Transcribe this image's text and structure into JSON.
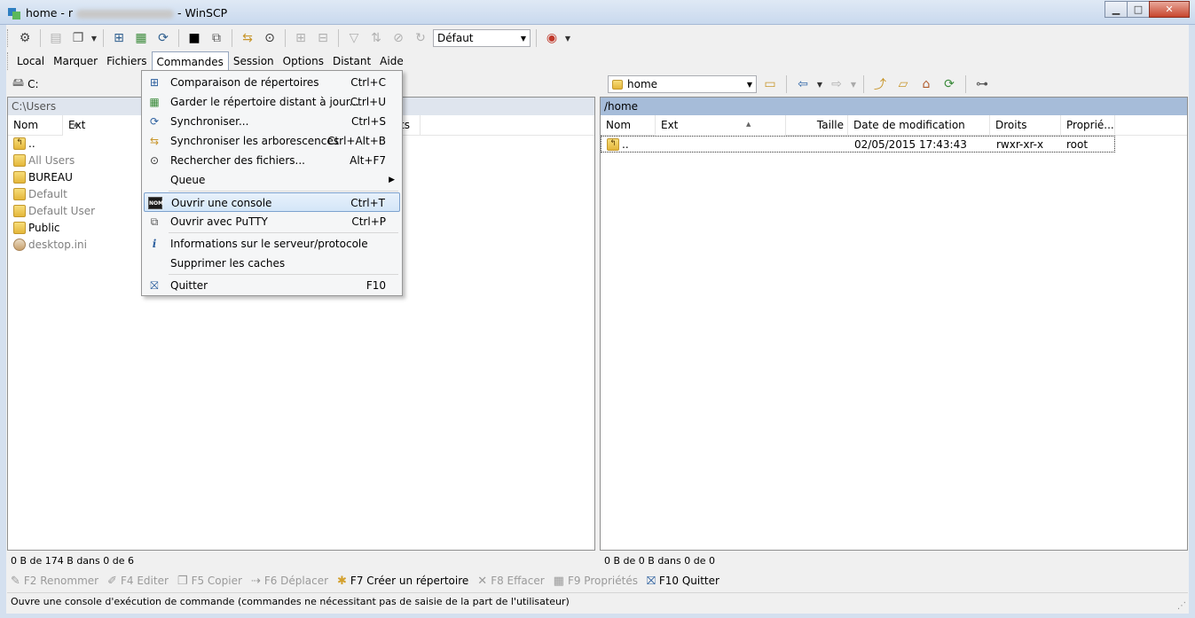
{
  "window": {
    "title_prefix": "home - r",
    "title_suffix": "- WinSCP",
    "buttons": {
      "minimize": "▁",
      "maximize": "□",
      "close": "✕"
    }
  },
  "toolbar": {
    "transfer_preset": "Défaut"
  },
  "menubar": {
    "items": [
      "Local",
      "Marquer",
      "Fichiers",
      "Commandes",
      "Session",
      "Options",
      "Distant",
      "Aide"
    ]
  },
  "left_panel": {
    "drive": "C:",
    "path": "C:\\Users",
    "columns": {
      "name": "Nom",
      "ext": "Ext",
      "hidden_tail": "ts"
    },
    "rows": [
      {
        "name": "..",
        "icon": "parent-folder-icon",
        "hidden": false
      },
      {
        "name": "All Users",
        "icon": "folder-icon",
        "hidden": true
      },
      {
        "name": "BUREAU",
        "icon": "folder-icon",
        "hidden": false
      },
      {
        "name": "Default",
        "icon": "folder-icon",
        "hidden": true
      },
      {
        "name": "Default User",
        "icon": "folder-icon",
        "hidden": true
      },
      {
        "name": "Public",
        "icon": "folder-icon",
        "hidden": false
      },
      {
        "name": "desktop.ini",
        "icon": "settings-file-icon",
        "hidden": true
      }
    ],
    "status": "0 B de 174 B dans 0 de 6"
  },
  "right_panel": {
    "path_combo": "home",
    "path": "/home",
    "columns": {
      "name": "Nom",
      "ext": "Ext",
      "size": "Taille",
      "modified": "Date de modification",
      "rights": "Droits",
      "owner": "Proprié..."
    },
    "rows": [
      {
        "name": "..",
        "modified": "02/05/2015 17:43:43",
        "rights": "rwxr-xr-x",
        "owner": "root"
      }
    ],
    "status": "0 B de 0 B dans 0 de 0"
  },
  "commands_menu": {
    "items": [
      {
        "label": "Comparaison de répertoires",
        "shortcut": "Ctrl+C",
        "icon": "compare-directories-icon"
      },
      {
        "label": "Garder le répertoire distant à jour...",
        "shortcut": "Ctrl+U",
        "icon": "keep-up-to-date-icon"
      },
      {
        "label": "Synchroniser...",
        "shortcut": "Ctrl+S",
        "icon": "synchronize-icon"
      },
      {
        "label": "Synchroniser les arborescences",
        "shortcut": "Ctrl+Alt+B",
        "icon": "sync-browsing-icon"
      },
      {
        "label": "Rechercher des fichiers...",
        "shortcut": "Alt+F7",
        "icon": "binoculars-icon"
      },
      {
        "label": "Queue",
        "shortcut": "",
        "icon": ""
      },
      {
        "label": "Ouvrir une console",
        "shortcut": "Ctrl+T",
        "icon": "console-icon"
      },
      {
        "label": "Ouvrir avec PuTTY",
        "shortcut": "Ctrl+P",
        "icon": "putty-icon"
      },
      {
        "label": "Informations sur le serveur/protocole",
        "shortcut": "",
        "icon": "info-icon"
      },
      {
        "label": "Supprimer les caches",
        "shortcut": "",
        "icon": ""
      },
      {
        "label": "Quitter",
        "shortcut": "F10",
        "icon": "quit-icon"
      }
    ],
    "highlighted_index": 6
  },
  "fkeys": [
    {
      "label": "F2 Renommer",
      "enabled": false
    },
    {
      "label": "F4 Editer",
      "enabled": false
    },
    {
      "label": "F5 Copier",
      "enabled": false
    },
    {
      "label": "F6 Déplacer",
      "enabled": false
    },
    {
      "label": "F7 Créer un répertoire",
      "enabled": true
    },
    {
      "label": "F8 Effacer",
      "enabled": false
    },
    {
      "label": "F9 Propriétés",
      "enabled": false
    },
    {
      "label": "F10 Quitter",
      "enabled": true
    }
  ],
  "hint": "Ouvre une console d'exécution de commande (commandes ne nécessitant pas de saisie de la part de l'utilisateur)",
  "colors": {
    "active_path_bg": "#a6bcd9",
    "menu_highlight": "#d4e6f8"
  }
}
